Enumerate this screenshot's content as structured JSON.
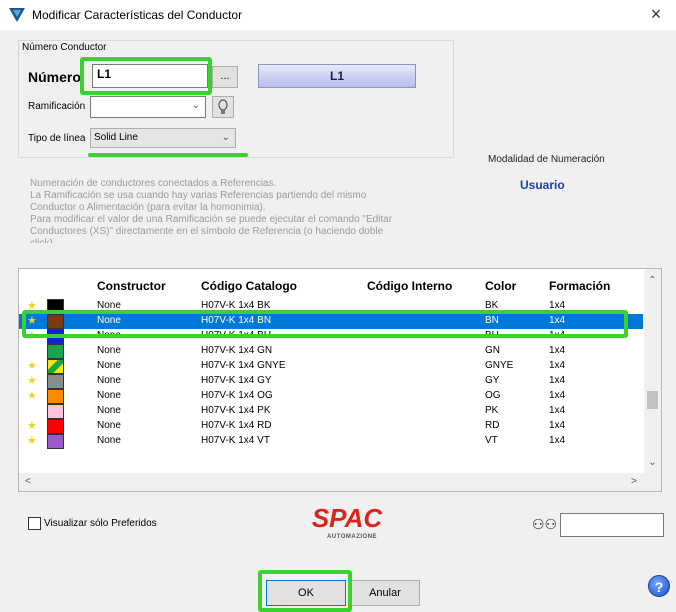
{
  "window": {
    "title": "Modificar Características del Conductor",
    "close_glyph": "×"
  },
  "group": {
    "legend": "Número Conductor"
  },
  "numero": {
    "label": "Número",
    "value": "L1",
    "dots_label": "...",
    "display": "L1"
  },
  "ramificacion": {
    "label": "Ramificación",
    "value": ""
  },
  "tipo_linea": {
    "label": "Tipo de línea",
    "value": "Solid Line"
  },
  "modalidad": {
    "label": "Modalidad de Numeración",
    "value": "Usuario"
  },
  "info_lines": [
    "Numeración de conductores conectados a Referencias.",
    "La Ramificación se usa cuando hay varias Referencias partiendo del mismo",
    "Conductor o Alimentación (para evitar la homonimia).",
    "Para modificar el valor de una Ramificación se puede ejecutar el comando \"Editar",
    "Conductores (XS)\" directamente en el símbolo de Referencia (o haciendo doble",
    "click)"
  ],
  "table": {
    "headers": [
      "Constructor",
      "Código Catalogo",
      "Código Interno",
      "Color",
      "Formación"
    ],
    "rows": [
      {
        "star": true,
        "swatch": "#000000",
        "constructor": "None",
        "codigo": "H07V-K  1x4 BK",
        "interno": "",
        "color": "BK",
        "formacion": "1x4"
      },
      {
        "star": true,
        "swatch": "#7a3a0c",
        "constructor": "None",
        "codigo": "H07V-K  1x4 BN",
        "interno": "",
        "color": "BN",
        "formacion": "1x4",
        "selected": true
      },
      {
        "star": true,
        "swatch": "#0b24d8",
        "constructor": "None",
        "codigo": "H07V-K  1x4 BU",
        "interno": "",
        "color": "BU",
        "formacion": "1x4"
      },
      {
        "star": false,
        "swatch": "#1aa34a",
        "constructor": "None",
        "codigo": "H07V-K  1x4 GN",
        "interno": "",
        "color": "GN",
        "formacion": "1x4"
      },
      {
        "star": true,
        "swatch": "gnye",
        "constructor": "None",
        "codigo": "H07V-K  1x4 GNYE",
        "interno": "",
        "color": "GNYE",
        "formacion": "1x4"
      },
      {
        "star": true,
        "swatch": "#8c8c8c",
        "constructor": "None",
        "codigo": "H07V-K  1x4 GY",
        "interno": "",
        "color": "GY",
        "formacion": "1x4"
      },
      {
        "star": true,
        "swatch": "#ff8c00",
        "constructor": "None",
        "codigo": "H07V-K  1x4 OG",
        "interno": "",
        "color": "OG",
        "formacion": "1x4"
      },
      {
        "star": false,
        "swatch": "#ffc2dd",
        "constructor": "None",
        "codigo": "H07V-K  1x4 PK",
        "interno": "",
        "color": "PK",
        "formacion": "1x4"
      },
      {
        "star": true,
        "swatch": "#ff0000",
        "constructor": "None",
        "codigo": "H07V-K  1x4 RD",
        "interno": "",
        "color": "RD",
        "formacion": "1x4"
      },
      {
        "star": true,
        "swatch": "#9b59c9",
        "constructor": "None",
        "codigo": "H07V-K  1x4 VT",
        "interno": "",
        "color": "VT",
        "formacion": "1x4"
      }
    ]
  },
  "preferidos": {
    "label": "Visualizar sólo Preferidos",
    "checked": false
  },
  "logo": {
    "text": "SPAC",
    "sub": "AUTOMAZIONE"
  },
  "search": {
    "value": ""
  },
  "buttons": {
    "ok": "OK",
    "anular": "Anular",
    "help": "?"
  },
  "colors": {
    "highlight": "#3ad22c",
    "selection": "#0078d7",
    "usuario": "#1f3fa6",
    "logo_red": "#d9251d"
  }
}
